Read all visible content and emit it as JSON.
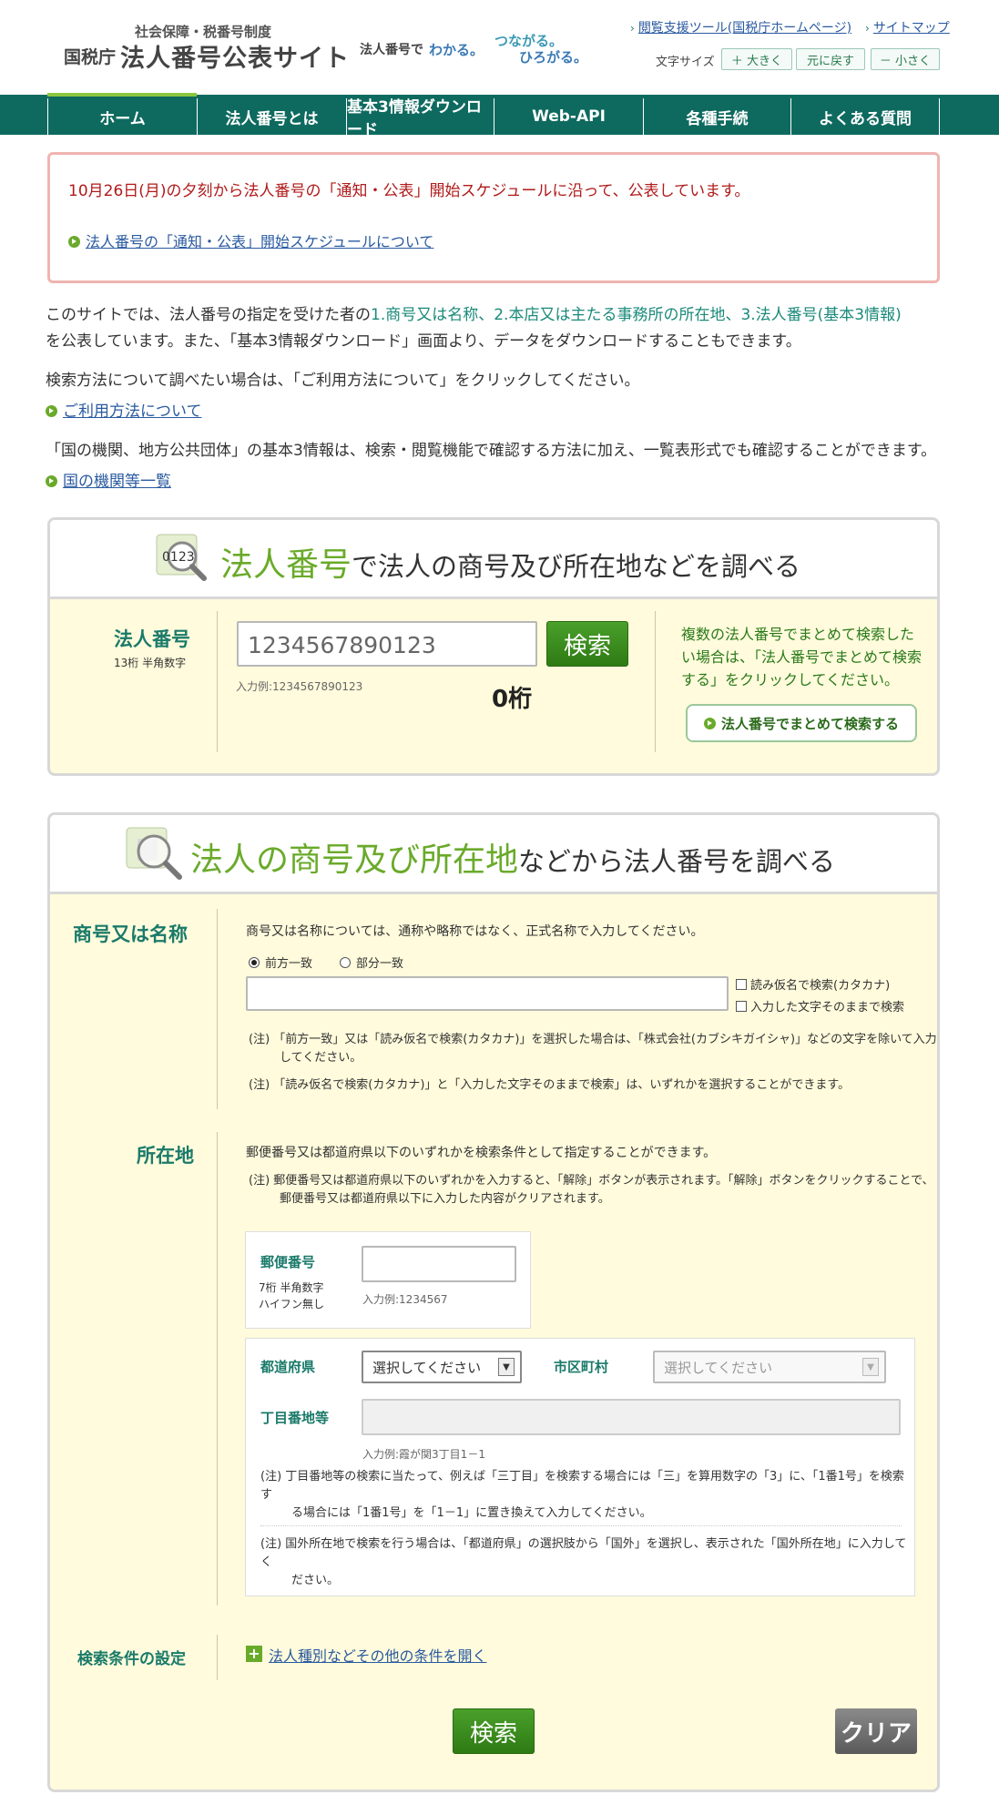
{
  "header": {
    "org": "社会保障・税番号制度",
    "nta": "国税庁",
    "title": "法人番号公表サイト",
    "tagline_a": "法人番号で",
    "tagline_b": "わかる。",
    "tagline_c": "つながる。",
    "tagline_d": "ひろがる。",
    "link_viewer": "閲覧支援ツール(国税庁ホームページ)",
    "link_sitemap": "サイトマップ",
    "fontsize_label": "文字サイズ",
    "fs_large": "＋ 大きく",
    "fs_reset": "元に戻す",
    "fs_small": "－ 小さく"
  },
  "nav": {
    "items": [
      "ホーム",
      "法人番号とは",
      "基本3情報ダウンロード",
      "Web-API",
      "各種手続",
      "よくある質問"
    ]
  },
  "notice": {
    "message": "10月26日(月)の夕刻から法人番号の「通知・公表」開始スケジュールに沿って、公表しています。",
    "link": "法人番号の「通知・公表」開始スケジュールについて"
  },
  "intro": {
    "line1_a": "このサイトでは、法人番号の指定を受けた者の",
    "line1_b": "1.商号又は名称、2.本店又は主たる事務所の所在地、3.法人番号(基本3情報)",
    "line2": "を公表しています。また、「基本3情報ダウンロード」画面より、データをダウンロードすることもできます。",
    "line3": "検索方法について調べたい場合は、「ご利用方法について」をクリックしてください。",
    "link_usage": "ご利用方法について",
    "line4": "「国の機関、地方公共団体」の基本3情報は、検索・閲覧機能で確認する方法に加え、一覧表形式でも確認することができます。",
    "link_agencies": "国の機関等一覧"
  },
  "number_search": {
    "icon_text": "0123",
    "title_green": "法人番号",
    "title_rest": "で法人の商号及び所在地などを調べる",
    "label": "法人番号",
    "sublabel": "13桁 半角数字",
    "placeholder": "1234567890123",
    "example": "入力例:1234567890123",
    "search_button": "検索",
    "digit_count": "0桁",
    "bulk_text": "複数の法人番号でまとめて検索したい場合は、「法人番号でまとめて検索する」をクリックしてください。",
    "bulk_button": "法人番号でまとめて検索する"
  },
  "name_search": {
    "title_green": "法人の商号及び所在地",
    "title_rest": "などから法人番号を調べる",
    "name_label": "商号又は名称",
    "name_desc": "商号又は名称については、通称や略称ではなく、正式名称で入力してください。",
    "radio_prefix": "前方一致",
    "radio_partial": "部分一致",
    "check_kana": "読み仮名で検索(カタカナ)",
    "check_exact": "入力した文字そのままで検索",
    "note1_a": "(注) 「前方一致」又は「読み仮名で検索(カタカナ)」を選択した場合は、「株式会社(カブシキガイシャ)」などの文字を除いて入力",
    "note1_b": "してください。",
    "note2": "(注) 「読み仮名で検索(カタカナ)」と「入力した文字そのままで検索」は、いずれかを選択することができます。",
    "loc_label": "所在地",
    "loc_desc": "郵便番号又は都道府県以下のいずれかを検索条件として指定することができます。",
    "loc_note_a": "(注) 郵便番号又は都道府県以下のいずれかを入力すると、「解除」ボタンが表示されます。「解除」ボタンをクリックすることで、",
    "loc_note_b": "郵便番号又は都道府県以下に入力した内容がクリアされます。",
    "zip_label": "郵便番号",
    "zip_sub1": "7桁 半角数字",
    "zip_sub2": "ハイフン無し",
    "zip_example": "入力例:1234567",
    "pref_label": "都道府県",
    "pref_value": "選択してください",
    "city_label": "市区町村",
    "city_value": "選択してください",
    "street_label": "丁目番地等",
    "street_example": "入力例:霞が関3丁目1－1",
    "street_note_a": "(注) 丁目番地等の検索に当たって、例えば「三丁目」を検索する場合には「三」を算用数字の「3」に、「1番1号」を検索す",
    "street_note_b": "る場合には「1番1号」を「1－1」に置き換えて入力してください。",
    "foreign_note_a": "(注) 国外所在地で検索を行う場合は、「都道府県」の選択肢から「国外」を選択し、表示された「国外所在地」に入力してく",
    "foreign_note_b": "ださい。",
    "cond_label": "検索条件の設定",
    "cond_link": "法人種別などその他の条件を開く",
    "search_button": "検索",
    "clear_button": "クリア"
  }
}
